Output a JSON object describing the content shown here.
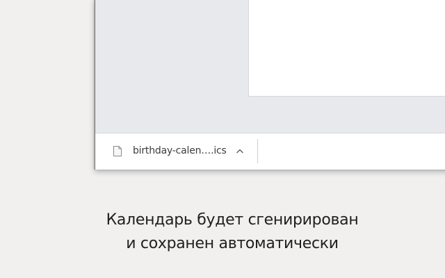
{
  "download_shelf": {
    "item": {
      "file_name": "birthday-calen….ics",
      "file_icon": "document-icon",
      "menu_icon": "chevron-up-icon"
    }
  },
  "caption": {
    "line1": "Календарь будет сгенирирован",
    "line2": "и сохранен автоматически"
  },
  "colors": {
    "background": "#f1f0ee",
    "window_chrome": "#e8e9ed",
    "page": "#ffffff",
    "text": "#3c3c3c"
  }
}
